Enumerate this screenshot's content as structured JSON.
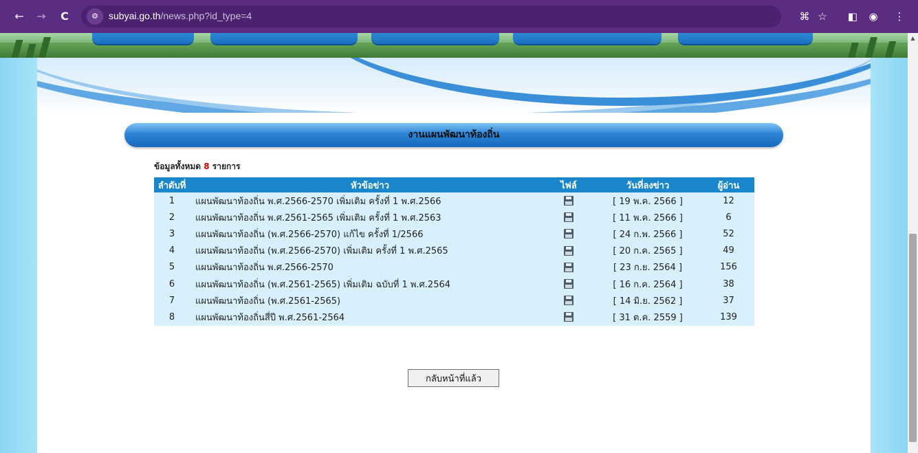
{
  "browser": {
    "url_host": "subyai.go.th",
    "url_path": "/news.php?id_type=4",
    "site_info_icon": "tune-icon"
  },
  "page": {
    "section_title": "งานแผนพัฒนาท้องถิ่น",
    "total_prefix": "ข้อมูลทั้งหมด",
    "total_count": "8",
    "total_suffix": "รายการ",
    "back_button": "กลับหน้าที่แล้ว"
  },
  "table": {
    "headers": {
      "no": "ลำดับที่",
      "title": "หัวข้อข่าว",
      "file": "ไฟล์",
      "date": "วันที่ลงข่าว",
      "reads": "ผู้อ่าน"
    },
    "rows": [
      {
        "no": "1",
        "title": "แผนพัฒนาท้องถิ่น พ.ศ.2566-2570 เพิ่มเติม ครั้งที่ 1 พ.ศ.2566",
        "date": "[ 19 พ.ค. 2566 ]",
        "reads": "12"
      },
      {
        "no": "2",
        "title": "แผนพัฒนาท้องถิ่น พ.ศ.2561-2565 เพิ่มเติม ครั้งที่ 1 พ.ศ.2563",
        "date": "[ 11 พ.ค. 2566 ]",
        "reads": "6"
      },
      {
        "no": "3",
        "title": "แผนพัฒนาท้องถิ่น (พ.ศ.2566-2570) แก้ไข ครั้งที่ 1/2566",
        "date": "[ 24 ก.พ. 2566 ]",
        "reads": "52"
      },
      {
        "no": "4",
        "title": "แผนพัฒนาท้องถิ่น (พ.ศ.2566-2570) เพิ่มเติม ครั้งที่ 1 พ.ศ.2565",
        "date": "[ 20 ก.ค. 2565 ]",
        "reads": "49"
      },
      {
        "no": "5",
        "title": "แผนพัฒนาท้องถิ่น พ.ศ.2566-2570",
        "date": "[ 23 ก.ย. 2564 ]",
        "reads": "156"
      },
      {
        "no": "6",
        "title": "แผนพัฒนาท้องถิ่น (พ.ศ.2561-2565) เพิ่มเติม ฉบับที่ 1 พ.ศ.2564",
        "date": "[ 16 ก.ค. 2564 ]",
        "reads": "38"
      },
      {
        "no": "7",
        "title": "แผนพัฒนาท้องถิ่น (พ.ศ.2561-2565)",
        "date": "[ 14 มิ.ย. 2562 ]",
        "reads": "37"
      },
      {
        "no": "8",
        "title": "แผนพัฒนาท้องถิ่นสี่ปี พ.ศ.2561-2564",
        "date": "[ 31 ต.ค. 2559 ]",
        "reads": "139"
      }
    ]
  },
  "colors": {
    "chrome": "#5b2d82",
    "table_header": "#1a86cc",
    "row_bg": "#d8f0fb",
    "count_red": "#dd0000"
  }
}
